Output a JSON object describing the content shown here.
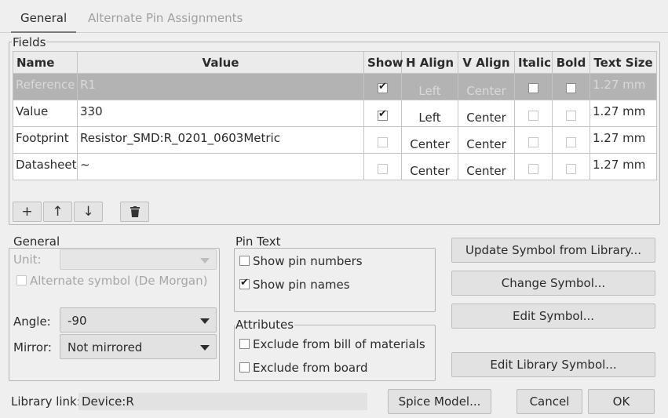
{
  "tabs": [
    {
      "label": "General",
      "active": true
    },
    {
      "label": "Alternate Pin Assignments",
      "active": false
    }
  ],
  "fields": {
    "legend": "Fields",
    "columns": [
      "Name",
      "Value",
      "Show",
      "H Align",
      "V Align",
      "Italic",
      "Bold",
      "Text Size"
    ],
    "rows": [
      {
        "name": "Reference",
        "value": "R1",
        "show": true,
        "h_align": "Left",
        "v_align": "Center",
        "italic": false,
        "bold": false,
        "text_size": "1.27 mm"
      },
      {
        "name": "Value",
        "value": "330",
        "show": true,
        "h_align": "Left",
        "v_align": "Center",
        "italic": false,
        "bold": false,
        "text_size": "1.27 mm"
      },
      {
        "name": "Footprint",
        "value": "Resistor_SMD:R_0201_0603Metric",
        "show": false,
        "h_align": "Center",
        "v_align": "Center",
        "italic": false,
        "bold": false,
        "text_size": "1.27 mm"
      },
      {
        "name": "Datasheet",
        "value": "~",
        "show": false,
        "h_align": "Center",
        "v_align": "Center",
        "italic": false,
        "bold": false,
        "text_size": "1.27 mm"
      }
    ],
    "buttons": {
      "add": "+",
      "up": "↑",
      "down": "↓",
      "delete": "🗑"
    }
  },
  "general": {
    "legend": "General",
    "unit_label": "Unit:",
    "unit_value": "",
    "alternate_symbol": {
      "label": "Alternate symbol (De Morgan)",
      "checked": false
    },
    "angle_label": "Angle:",
    "angle_value": "-90",
    "mirror_label": "Mirror:",
    "mirror_value": "Not mirrored"
  },
  "pin_text": {
    "legend": "Pin Text",
    "show_pin_numbers": {
      "label": "Show pin numbers",
      "checked": false
    },
    "show_pin_names": {
      "label": "Show pin names",
      "checked": true
    }
  },
  "attributes": {
    "legend": "Attributes",
    "exclude_bom": {
      "label": "Exclude from bill of materials",
      "checked": false
    },
    "exclude_board": {
      "label": "Exclude from board",
      "checked": false
    }
  },
  "actions": {
    "update_symbol": "Update Symbol from Library...",
    "change_symbol": "Change Symbol...",
    "edit_symbol": "Edit Symbol...",
    "edit_library_symbol": "Edit Library Symbol..."
  },
  "footer": {
    "library_link_label": "Library link:",
    "library_link_value": "Device:R",
    "spice_model": "Spice Model...",
    "cancel": "Cancel",
    "ok": "OK"
  },
  "icons": {
    "check": "✔",
    "dropdown": "chevron-down-icon"
  }
}
